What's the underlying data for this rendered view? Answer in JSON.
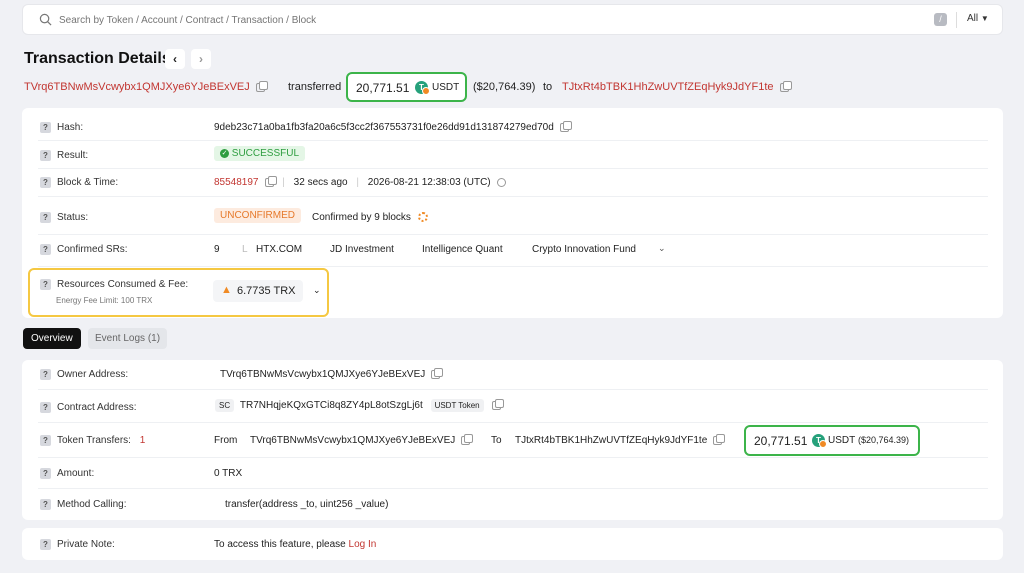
{
  "search": {
    "placeholder": "Search by Token / Account / Contract / Transaction / Block",
    "slash": "/",
    "scope": "All"
  },
  "header": {
    "title": "Transaction Details",
    "from_address": "TVrq6TBNwMsVcwybx1QMJXye6YJeBExVEJ",
    "transferred_label": "transferred",
    "amount": "20,771.51",
    "token": "USDT",
    "usd_value": "($20,764.39)",
    "to_label": "to",
    "to_address": "TJtxRt4bTBK1HhZwUVTfZEqHyk9JdYF1te"
  },
  "details": {
    "hash_label": "Hash:",
    "hash": "9deb23c71a0ba1fb3fa20a6c5f3cc2f367553731f0e26dd91d131874279ed70d",
    "result_label": "Result:",
    "result": "SUCCESSFUL",
    "block_label": "Block & Time:",
    "block": "85548197",
    "age": "32 secs ago",
    "time": "2026-08-21 12:38:03 (UTC)",
    "status_label": "Status:",
    "status": "UNCONFIRMED",
    "confirmed_by": "Confirmed by 9 blocks",
    "srs_label": "Confirmed SRs:",
    "srs_count": "9",
    "srs": [
      "HTX.COM",
      "JD Investment",
      "Intelligence Quant",
      "Crypto Innovation Fund"
    ],
    "resources_label": "Resources Consumed & Fee:",
    "energy_limit": "Energy Fee Limit: 100 TRX",
    "fee": "6.7735 TRX"
  },
  "tabs": {
    "overview": "Overview",
    "event_logs": "Event Logs (1)"
  },
  "overview": {
    "owner_label": "Owner Address:",
    "owner": "TVrq6TBNwMsVcwybx1QMJXye6YJeBExVEJ",
    "contract_label": "Contract Address:",
    "contract_badge": "SC",
    "contract": "TR7NHqjeKQxGTCi8q8ZY4pL8otSzgLj6t",
    "contract_token": "USDT Token",
    "transfers_label": "Token Transfers:",
    "transfers_count": "1",
    "from_label": "From",
    "from": "TVrq6TBNwMsVcwybx1QMJXye6YJeBExVEJ",
    "to_label": "To",
    "to": "TJtxRt4bTBK1HhZwUVTfZEqHyk9JdYF1te",
    "amount": "20,771.51",
    "token": "USDT",
    "usd_value": "($20,764.39)",
    "amount_label": "Amount:",
    "amount_trx": "0 TRX",
    "method_label": "Method Calling:",
    "method": "transfer(address _to, uint256 _value)"
  },
  "note": {
    "label": "Private Note:",
    "text": "To access this feature, please",
    "link": "Log In"
  },
  "colors": {
    "accent_red": "#c23631",
    "success_green": "#3cb44a",
    "warning_orange": "#f08a24",
    "highlight_yellow": "#f5c842"
  }
}
